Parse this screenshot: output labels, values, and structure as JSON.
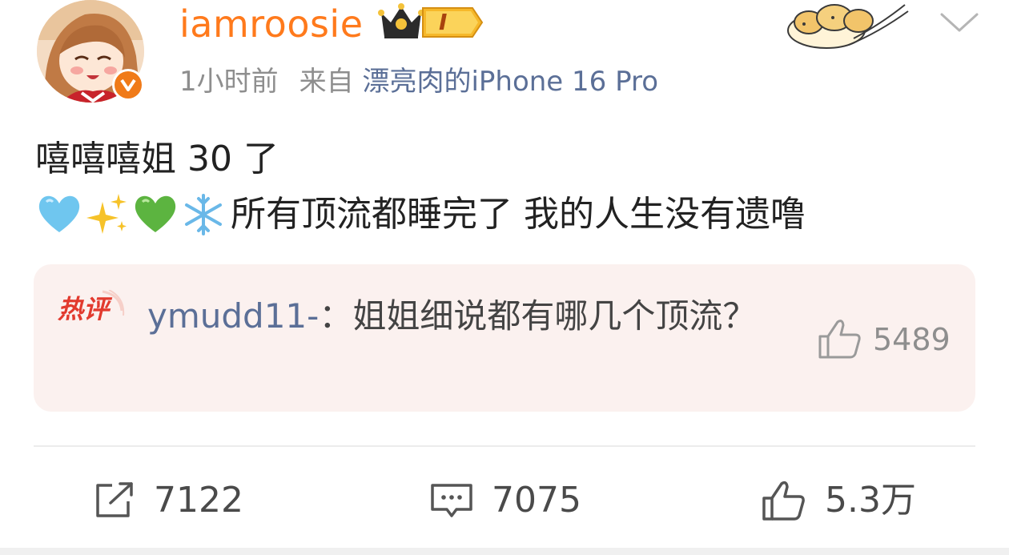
{
  "user": {
    "username": "iamroosie",
    "level_badge": "I"
  },
  "meta": {
    "time": "1小时前",
    "from_label": "来自",
    "source": "漂亮肉的iPhone 16 Pro"
  },
  "post": {
    "line1": "嘻嘻嘻姐 30 了",
    "emoji": [
      "💙",
      "✨",
      "💚",
      "❄️"
    ],
    "line2": "所有顶流都睡完了 我的人生没有遗噜"
  },
  "hot_comment": {
    "tag": "热评",
    "user": "ymudd11-",
    "separator": "：",
    "text": "姐姐细说都有哪几个顶流？",
    "likes": "5489"
  },
  "actions": {
    "reposts": "7122",
    "comments": "7075",
    "likes": "5.3万"
  },
  "colors": {
    "username": "#ff7a1c",
    "link": "#5b6f97",
    "hot_box_bg": "#fbf1ef",
    "hot_tag": "#e23a2e",
    "verified_badge": "#f07a18"
  }
}
